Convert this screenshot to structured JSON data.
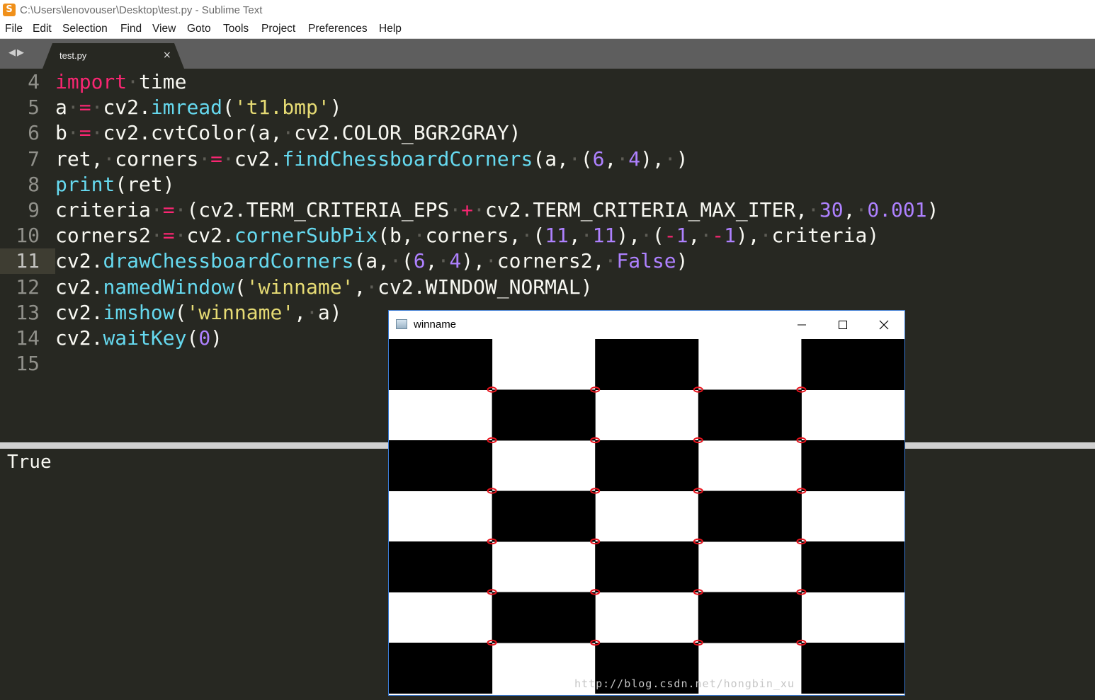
{
  "window": {
    "title": "C:\\Users\\lenovouser\\Desktop\\test.py - Sublime Text",
    "app_icon": "sublime-text-icon",
    "app_icon_glyph": "S"
  },
  "menu": [
    "File",
    "Edit",
    "Selection",
    "Find",
    "View",
    "Goto",
    "Tools",
    "Project",
    "Preferences",
    "Help"
  ],
  "tabs": {
    "nav_arrows": "◀▶",
    "active": {
      "label": "test.py",
      "close": "×"
    }
  },
  "editor": {
    "active_line": 11,
    "lines": [
      {
        "num": "4",
        "tokens": [
          [
            "kw",
            "import"
          ],
          [
            "ws",
            "·"
          ],
          [
            "tx",
            "time"
          ]
        ]
      },
      {
        "num": "5",
        "tokens": [
          [
            "tx",
            "a"
          ],
          [
            "ws",
            "·"
          ],
          [
            "kw",
            "="
          ],
          [
            "ws",
            "·"
          ],
          [
            "tx",
            "cv2."
          ],
          [
            "fn",
            "imread"
          ],
          [
            "tx",
            "("
          ],
          [
            "st",
            "'t1.bmp'"
          ],
          [
            "tx",
            ")"
          ]
        ]
      },
      {
        "num": "6",
        "tokens": [
          [
            "tx",
            "b"
          ],
          [
            "ws",
            "·"
          ],
          [
            "kw",
            "="
          ],
          [
            "ws",
            "·"
          ],
          [
            "tx",
            "cv2.cvtColor(a,"
          ],
          [
            "ws",
            "·"
          ],
          [
            "tx",
            "cv2.COLOR_BGR2GRAY)"
          ]
        ]
      },
      {
        "num": "7",
        "tokens": [
          [
            "tx",
            "ret,"
          ],
          [
            "ws",
            "·"
          ],
          [
            "tx",
            "corners"
          ],
          [
            "ws",
            "·"
          ],
          [
            "kw",
            "="
          ],
          [
            "ws",
            "·"
          ],
          [
            "tx",
            "cv2."
          ],
          [
            "fn",
            "findChessboardCorners"
          ],
          [
            "tx",
            "(a,"
          ],
          [
            "ws",
            "·"
          ],
          [
            "tx",
            "("
          ],
          [
            "nm",
            "6"
          ],
          [
            "tx",
            ","
          ],
          [
            "ws",
            "·"
          ],
          [
            "nm",
            "4"
          ],
          [
            "tx",
            "),"
          ],
          [
            "ws",
            "·"
          ],
          [
            "tx",
            ")"
          ]
        ]
      },
      {
        "num": "8",
        "tokens": [
          [
            "fn",
            "print"
          ],
          [
            "tx",
            "(ret)"
          ]
        ]
      },
      {
        "num": "9",
        "tokens": [
          [
            "tx",
            "criteria"
          ],
          [
            "ws",
            "·"
          ],
          [
            "kw",
            "="
          ],
          [
            "ws",
            "·"
          ],
          [
            "tx",
            "(cv2.TERM_CRITERIA_EPS"
          ],
          [
            "ws",
            "·"
          ],
          [
            "kw",
            "+"
          ],
          [
            "ws",
            "·"
          ],
          [
            "tx",
            "cv2.TERM_CRITERIA_MAX_ITER,"
          ],
          [
            "ws",
            "·"
          ],
          [
            "nm",
            "30"
          ],
          [
            "tx",
            ","
          ],
          [
            "ws",
            "·"
          ],
          [
            "nm",
            "0.001"
          ],
          [
            "tx",
            ")"
          ]
        ]
      },
      {
        "num": "10",
        "tokens": [
          [
            "tx",
            "corners2"
          ],
          [
            "ws",
            "·"
          ],
          [
            "kw",
            "="
          ],
          [
            "ws",
            "·"
          ],
          [
            "tx",
            "cv2."
          ],
          [
            "fn",
            "cornerSubPix"
          ],
          [
            "tx",
            "(b,"
          ],
          [
            "ws",
            "·"
          ],
          [
            "tx",
            "corners,"
          ],
          [
            "ws",
            "·"
          ],
          [
            "tx",
            "("
          ],
          [
            "nm",
            "11"
          ],
          [
            "tx",
            ","
          ],
          [
            "ws",
            "·"
          ],
          [
            "nm",
            "11"
          ],
          [
            "tx",
            "),"
          ],
          [
            "ws",
            "·"
          ],
          [
            "tx",
            "("
          ],
          [
            "kw",
            "-"
          ],
          [
            "nm",
            "1"
          ],
          [
            "tx",
            ","
          ],
          [
            "ws",
            "·"
          ],
          [
            "kw",
            "-"
          ],
          [
            "nm",
            "1"
          ],
          [
            "tx",
            "),"
          ],
          [
            "ws",
            "·"
          ],
          [
            "tx",
            "criteria)"
          ]
        ]
      },
      {
        "num": "11",
        "tokens": [
          [
            "tx",
            "cv2."
          ],
          [
            "fn",
            "drawChessboardCorners"
          ],
          [
            "tx",
            "(a,"
          ],
          [
            "ws",
            "·"
          ],
          [
            "tx",
            "("
          ],
          [
            "nm",
            "6"
          ],
          [
            "tx",
            ","
          ],
          [
            "ws",
            "·"
          ],
          [
            "nm",
            "4"
          ],
          [
            "tx",
            "),"
          ],
          [
            "ws",
            "·"
          ],
          [
            "tx",
            "corners2,"
          ],
          [
            "ws",
            "·"
          ],
          [
            "nm",
            "False"
          ],
          [
            "tx",
            ")"
          ]
        ]
      },
      {
        "num": "12",
        "tokens": [
          [
            "tx",
            "cv2."
          ],
          [
            "fn",
            "namedWindow"
          ],
          [
            "tx",
            "("
          ],
          [
            "st",
            "'winname'"
          ],
          [
            "tx",
            ","
          ],
          [
            "ws",
            "·"
          ],
          [
            "tx",
            "cv2.WINDOW_NORMAL)"
          ]
        ]
      },
      {
        "num": "13",
        "tokens": [
          [
            "tx",
            "cv2."
          ],
          [
            "fn",
            "imshow"
          ],
          [
            "tx",
            "("
          ],
          [
            "st",
            "'winname'"
          ],
          [
            "tx",
            ","
          ],
          [
            "ws",
            "·"
          ],
          [
            "tx",
            "a)"
          ]
        ]
      },
      {
        "num": "14",
        "tokens": [
          [
            "tx",
            "cv2."
          ],
          [
            "fn",
            "waitKey"
          ],
          [
            "tx",
            "("
          ],
          [
            "nm",
            "0"
          ],
          [
            "tx",
            ")"
          ]
        ]
      },
      {
        "num": "15",
        "tokens": []
      }
    ]
  },
  "output_panel": {
    "text": "True"
  },
  "cv_window": {
    "title": "winname",
    "icon": "window-app-icon",
    "controls": [
      "minimize-icon",
      "maximize-icon",
      "close-icon"
    ],
    "chessboard": {
      "columns": 5,
      "rows": 7,
      "top_left_black": true,
      "corner_marker_color": "#e8141e"
    },
    "watermark": "http://blog.csdn.net/hongbin_xu"
  },
  "colors": {
    "editor_bg": "#272822",
    "keyword": "#f92672",
    "function": "#66d9ef",
    "string": "#e6db74",
    "number": "#ae81ff",
    "text": "#f8f8f2",
    "whitespace_dot": "#5e5d56",
    "gutter": "#90908a"
  }
}
